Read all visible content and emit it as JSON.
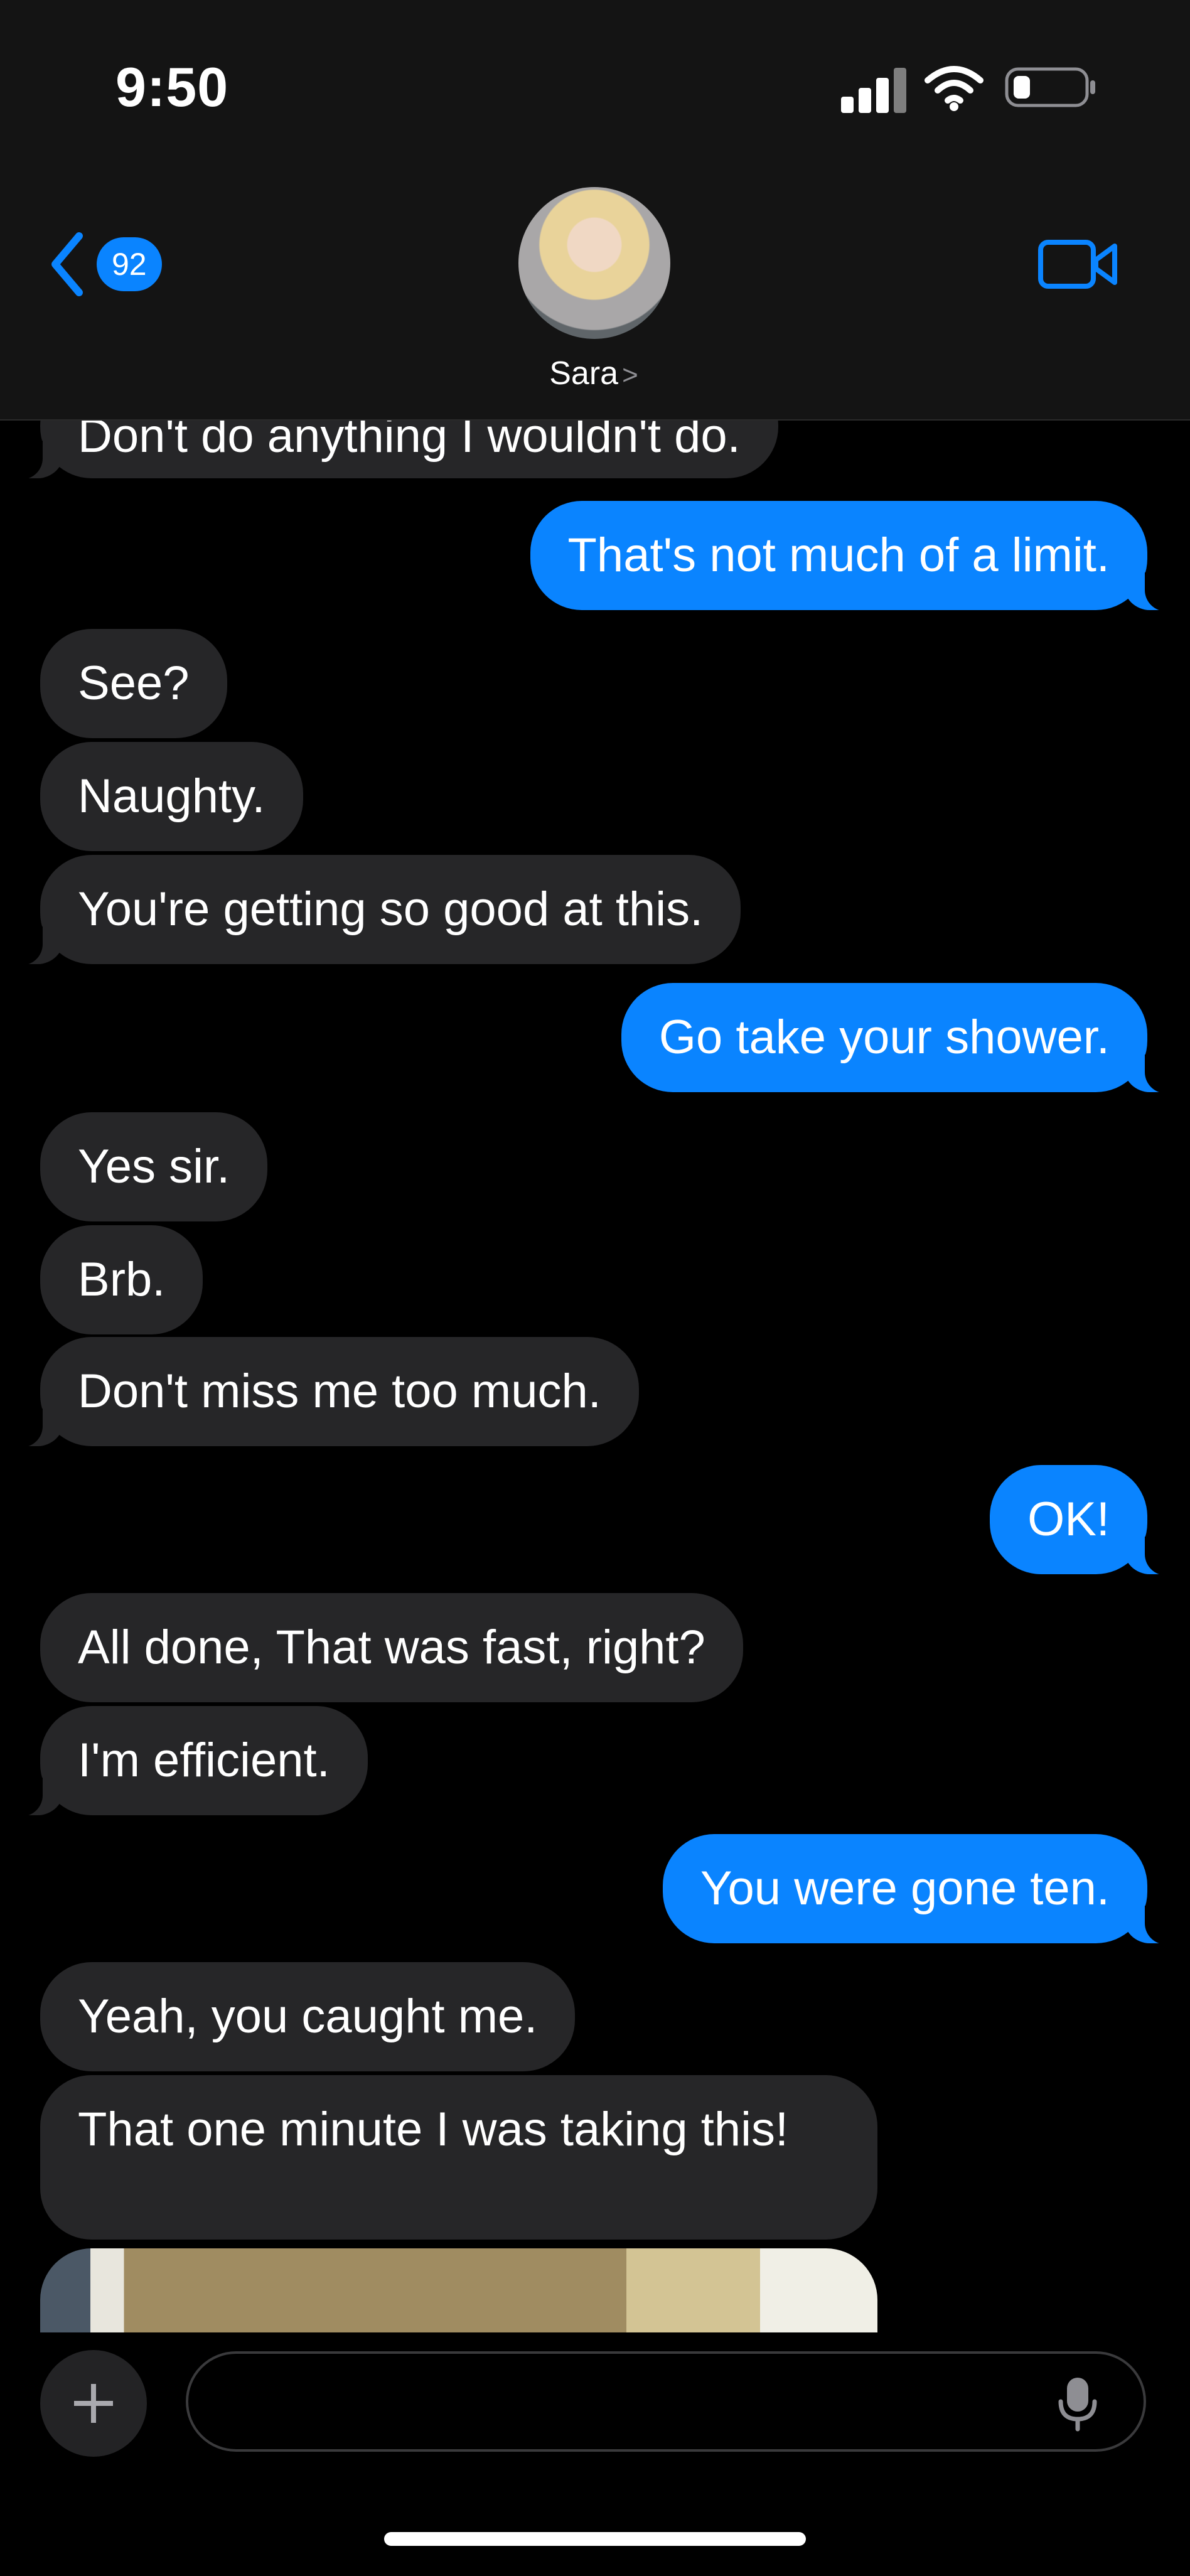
{
  "status_bar": {
    "time": "9:50"
  },
  "header": {
    "back_badge_count": "92",
    "contact_name": "Sara",
    "contact_chevron": ">"
  },
  "messages": [
    {
      "text": "Don't do anything I wouldn't do.",
      "direction": "in"
    },
    {
      "text": "That's not much of a limit.",
      "direction": "out"
    },
    {
      "text": "See?",
      "direction": "in"
    },
    {
      "text": "Naughty.",
      "direction": "in"
    },
    {
      "text": "You're getting so good at this.",
      "direction": "in"
    },
    {
      "text": "Go take your shower.",
      "direction": "out"
    },
    {
      "text": "Yes sir.",
      "direction": "in"
    },
    {
      "text": "Brb.",
      "direction": "in"
    },
    {
      "text": "Don't miss me too much.",
      "direction": "in"
    },
    {
      "text": "OK!",
      "direction": "out"
    },
    {
      "text": "All done, That was fast, right?",
      "direction": "in"
    },
    {
      "text": "I'm efficient.",
      "direction": "in"
    },
    {
      "text": "You were gone ten.",
      "direction": "out"
    },
    {
      "text": "Yeah, you caught me.",
      "direction": "in"
    },
    {
      "text": "That one minute I was taking this!",
      "direction": "in"
    }
  ],
  "composer": {
    "placeholder": ""
  },
  "colors": {
    "accent": "#0a84ff",
    "incoming_bubble": "#262628",
    "background": "#000000",
    "header_background": "#141414"
  },
  "icons": {
    "back": "chevron-left-icon",
    "video": "video-call-icon",
    "add": "plus-icon",
    "mic": "microphone-icon"
  }
}
